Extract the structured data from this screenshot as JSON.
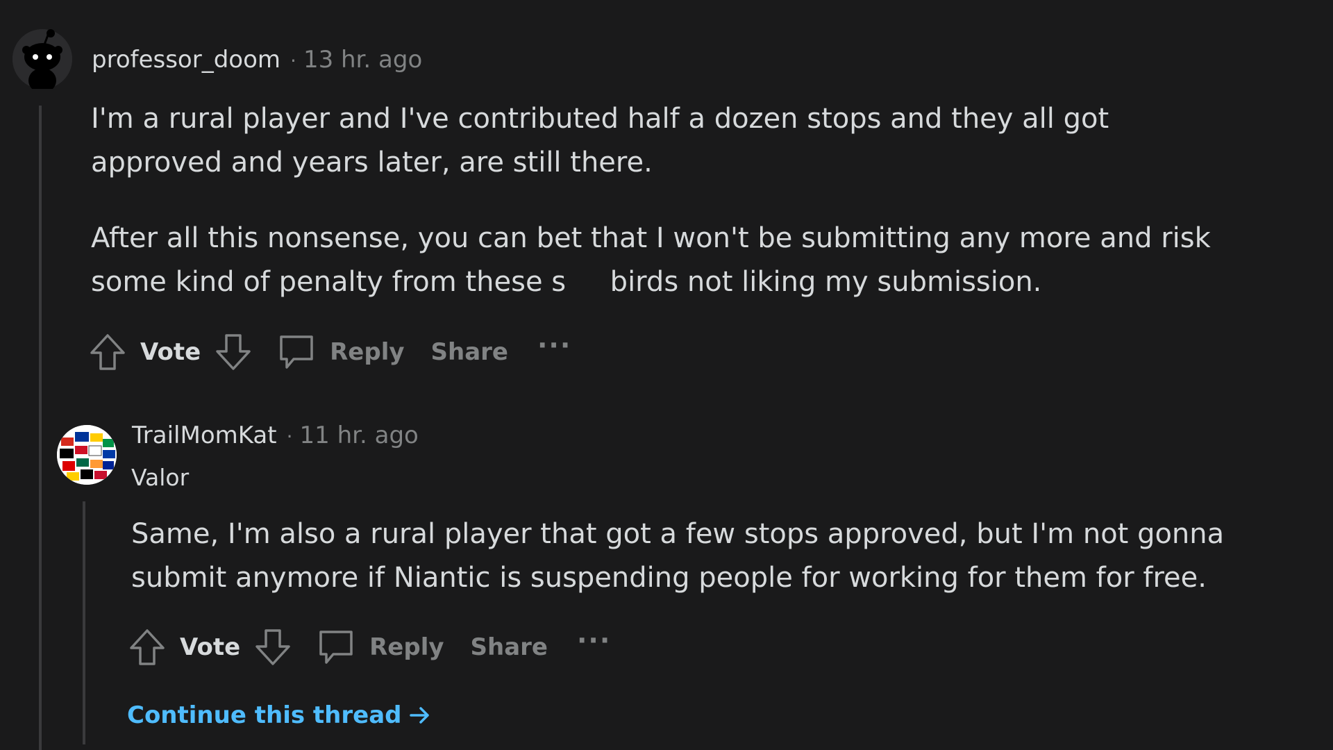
{
  "comment": {
    "author": "professor_doom",
    "separator": "·",
    "time": "13 hr. ago",
    "paragraph_1": "I'm a rural player and I've contributed half a dozen stops and they all got\napproved and years later, are still there.",
    "paragraph_2": "After all this nonsense, you can bet that I won't be submitting any more and risk\nsome kind of penalty from these s     birds not liking my submission.",
    "actions": {
      "vote_label": "Vote",
      "reply_label": "Reply",
      "share_label": "Share",
      "more_label": "···"
    }
  },
  "reply": {
    "author": "TrailMomKat",
    "separator": "·",
    "time": "11 hr. ago",
    "flair": "Valor",
    "paragraph_1": "Same, I'm also a rural player that got a few stops approved, but I'm not gonna\nsubmit anymore if Niantic is suspending people for working for them for free.",
    "actions": {
      "vote_label": "Vote",
      "reply_label": "Reply",
      "share_label": "Share",
      "more_label": "···"
    }
  },
  "continue_thread_label": "Continue this thread",
  "colors": {
    "background": "#1a1a1b",
    "text": "#d7dadc",
    "muted": "#818384",
    "link": "#4fbcff",
    "thread_line": "#3a3a3c"
  }
}
